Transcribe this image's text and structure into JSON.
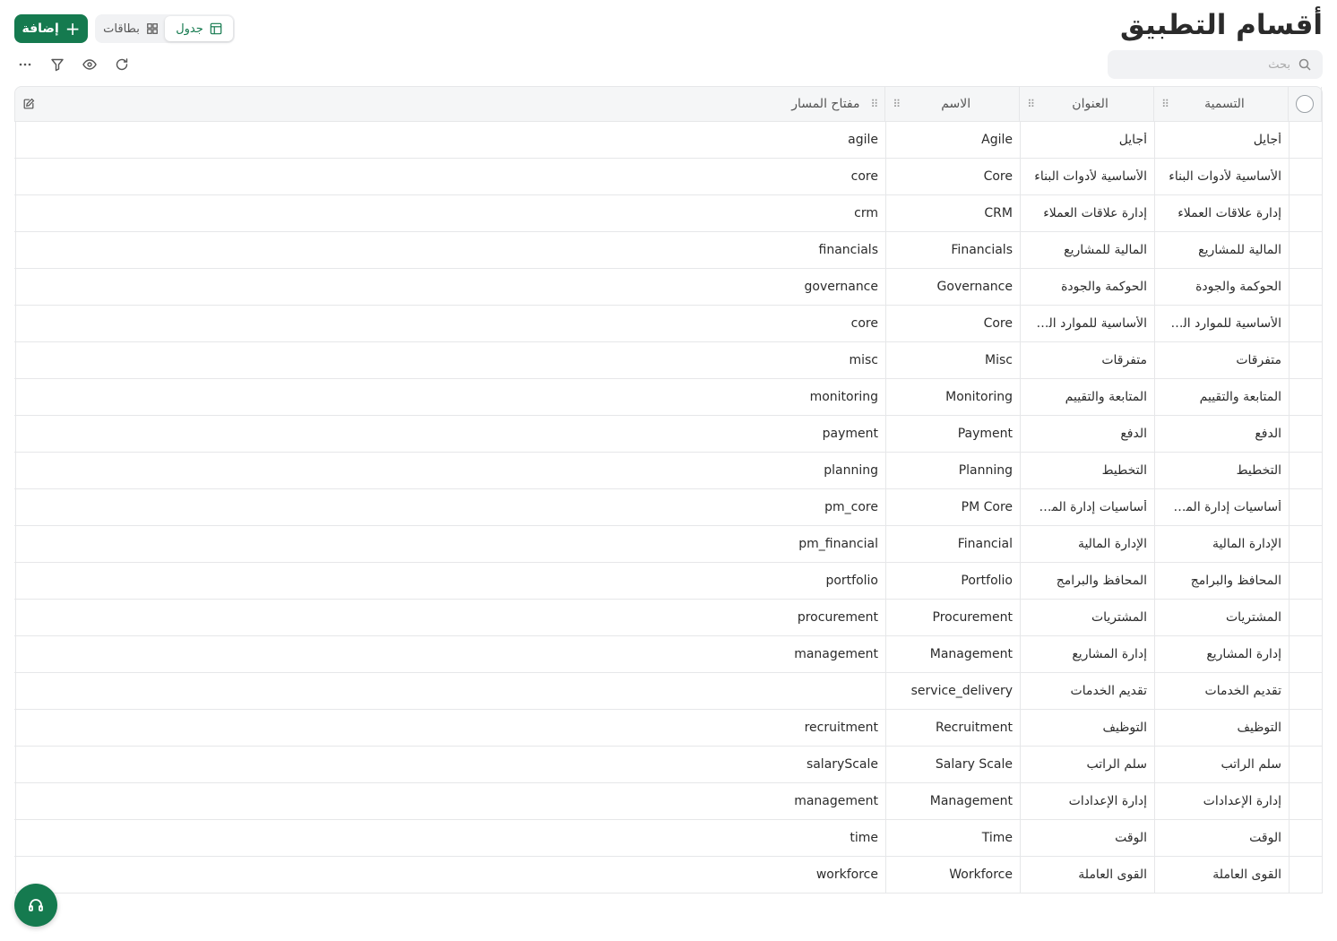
{
  "header": {
    "title": "أقسام التطبيق",
    "add_label": "إضافة",
    "view_table": "جدول",
    "view_cards": "بطاقات",
    "search_placeholder": "بحث"
  },
  "columns": {
    "label": "التسمية",
    "title": "العنوان",
    "name": "الاسم",
    "route_key": "مفتاح المسار"
  },
  "rows": [
    {
      "label": "أجايل",
      "title": "أجايل",
      "name": "Agile",
      "key": "agile"
    },
    {
      "label": "الأساسية لأدوات البناء",
      "title": "الأساسية لأدوات البناء",
      "name": "Core",
      "key": "core"
    },
    {
      "label": "إدارة علاقات العملاء",
      "title": "إدارة علاقات العملاء",
      "name": "CRM",
      "key": "crm"
    },
    {
      "label": "المالية للمشاريع",
      "title": "المالية للمشاريع",
      "name": "Financials",
      "key": "financials"
    },
    {
      "label": "الحوكمة والجودة",
      "title": "الحوكمة والجودة",
      "name": "Governance",
      "key": "governance"
    },
    {
      "label": "الأساسية للموارد الب...",
      "title": "الأساسية للموارد الب...",
      "name": "Core",
      "key": "core"
    },
    {
      "label": "متفرقات",
      "title": "متفرقات",
      "name": "Misc",
      "key": "misc"
    },
    {
      "label": "المتابعة والتقييم",
      "title": "المتابعة والتقييم",
      "name": "Monitoring",
      "key": "monitoring"
    },
    {
      "label": "الدفع",
      "title": "الدفع",
      "name": "Payment",
      "key": "payment"
    },
    {
      "label": "التخطيط",
      "title": "التخطيط",
      "name": "Planning",
      "key": "planning"
    },
    {
      "label": "أساسيات إدارة المش...",
      "title": "أساسيات إدارة المش...",
      "name": "PM Core",
      "key": "pm_core"
    },
    {
      "label": "الإدارة المالية",
      "title": "الإدارة المالية",
      "name": "Financial",
      "key": "pm_financial"
    },
    {
      "label": "المحافظ والبرامج",
      "title": "المحافظ والبرامج",
      "name": "Portfolio",
      "key": "portfolio"
    },
    {
      "label": "المشتريات",
      "title": "المشتريات",
      "name": "Procurement",
      "key": "procurement"
    },
    {
      "label": "إدارة المشاريع",
      "title": "إدارة المشاريع",
      "name": "Management",
      "key": "management"
    },
    {
      "label": "تقديم الخدمات",
      "title": "تقديم الخدمات",
      "name": "service_delivery",
      "key": ""
    },
    {
      "label": "التوظيف",
      "title": "التوظيف",
      "name": "Recruitment",
      "key": "recruitment"
    },
    {
      "label": "سلم الراتب",
      "title": "سلم الراتب",
      "name": "Salary Scale",
      "key": "salaryScale"
    },
    {
      "label": "إدارة الإعدادات",
      "title": "إدارة الإعدادات",
      "name": "Management",
      "key": "management"
    },
    {
      "label": "الوقت",
      "title": "الوقت",
      "name": "Time",
      "key": "time"
    },
    {
      "label": "القوى العاملة",
      "title": "القوى العاملة",
      "name": "Workforce",
      "key": "workforce"
    }
  ],
  "icons": {
    "plus": "plus-icon",
    "table": "table-icon",
    "grid": "grid-icon",
    "search": "search-icon",
    "refresh": "refresh-icon",
    "eye": "eye-icon",
    "filter": "filter-icon",
    "more": "more-icon",
    "edit": "edit-icon",
    "headset": "headset-icon"
  },
  "colors": {
    "accent": "#157a4f"
  }
}
